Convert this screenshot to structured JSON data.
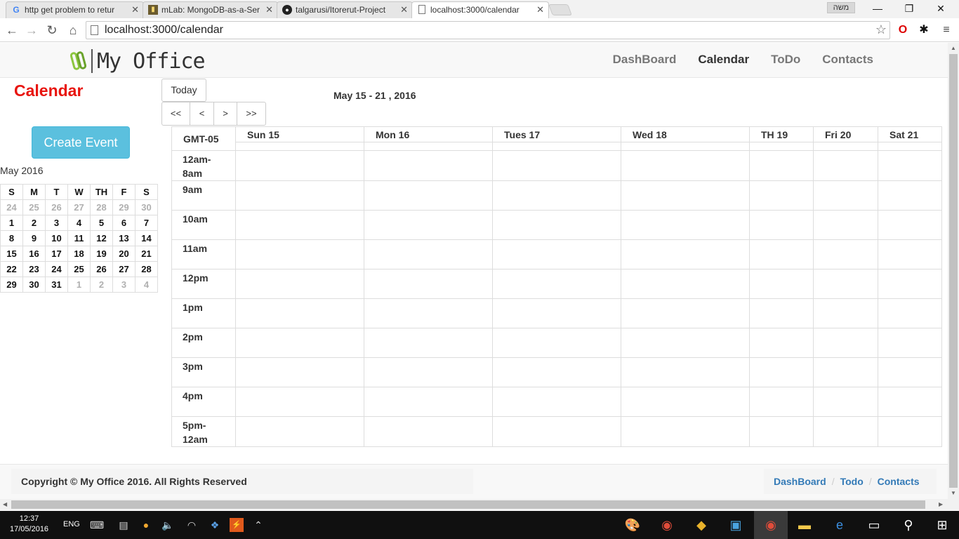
{
  "browser": {
    "tabs": [
      {
        "title": "http get problem to retur",
        "icon": "google-icon"
      },
      {
        "title": "mLab: MongoDB-as-a-Ser",
        "icon": "mlab-icon"
      },
      {
        "title": "talgarusi/Itorerut-Project",
        "icon": "github-icon"
      },
      {
        "title": "localhost:3000/calendar",
        "icon": "page-icon"
      }
    ],
    "profile_label": "משה",
    "url": "localhost:3000/calendar"
  },
  "header": {
    "brand": "My Office",
    "nav": [
      "DashBoard",
      "Calendar",
      "ToDo",
      "Contacts"
    ],
    "active_nav": "Calendar"
  },
  "calendar": {
    "page_title": "Calendar",
    "today_label": "Today",
    "nav_buttons": [
      "<<",
      "<",
      ">",
      ">>"
    ],
    "week_range": "May 15 - 21 , 2016",
    "create_event_label": "Create Event",
    "timezone": "GMT-05",
    "days": [
      "Sun 15",
      "Mon 16",
      "Tues 17",
      "Wed 18",
      "TH 19",
      "Fri 20",
      "Sat 21"
    ],
    "hours": [
      [
        "12am-",
        "8am"
      ],
      [
        "9am"
      ],
      [
        "10am"
      ],
      [
        "11am"
      ],
      [
        "12pm"
      ],
      [
        "1pm"
      ],
      [
        "2pm"
      ],
      [
        "3pm"
      ],
      [
        "4pm"
      ],
      [
        "5pm-",
        "12am"
      ]
    ]
  },
  "mini_calendar": {
    "month_label": "May 2016",
    "weekdays": [
      "S",
      "M",
      "T",
      "W",
      "TH",
      "F",
      "S"
    ],
    "weeks": [
      [
        "24",
        "25",
        "26",
        "27",
        "28",
        "29",
        "30"
      ],
      [
        "1",
        "2",
        "3",
        "4",
        "5",
        "6",
        "7"
      ],
      [
        "8",
        "9",
        "10",
        "11",
        "12",
        "13",
        "14"
      ],
      [
        "15",
        "16",
        "17",
        "18",
        "19",
        "20",
        "21"
      ],
      [
        "22",
        "23",
        "24",
        "25",
        "26",
        "27",
        "28"
      ],
      [
        "29",
        "30",
        "31",
        "1",
        "2",
        "3",
        "4"
      ]
    ],
    "muted_first_row": true,
    "muted_last_row_from": 3
  },
  "footer": {
    "copyright": "Copyright © My Office 2016. All Rights Reserved",
    "links": [
      "DashBoard",
      "Todo",
      "Contacts"
    ]
  },
  "taskbar": {
    "time": "12:37",
    "date": "17/05/2016",
    "lang": "ENG"
  },
  "colors": {
    "title_red": "#e8140e",
    "button_info": "#5bc0de",
    "link_blue": "#337ab7"
  }
}
